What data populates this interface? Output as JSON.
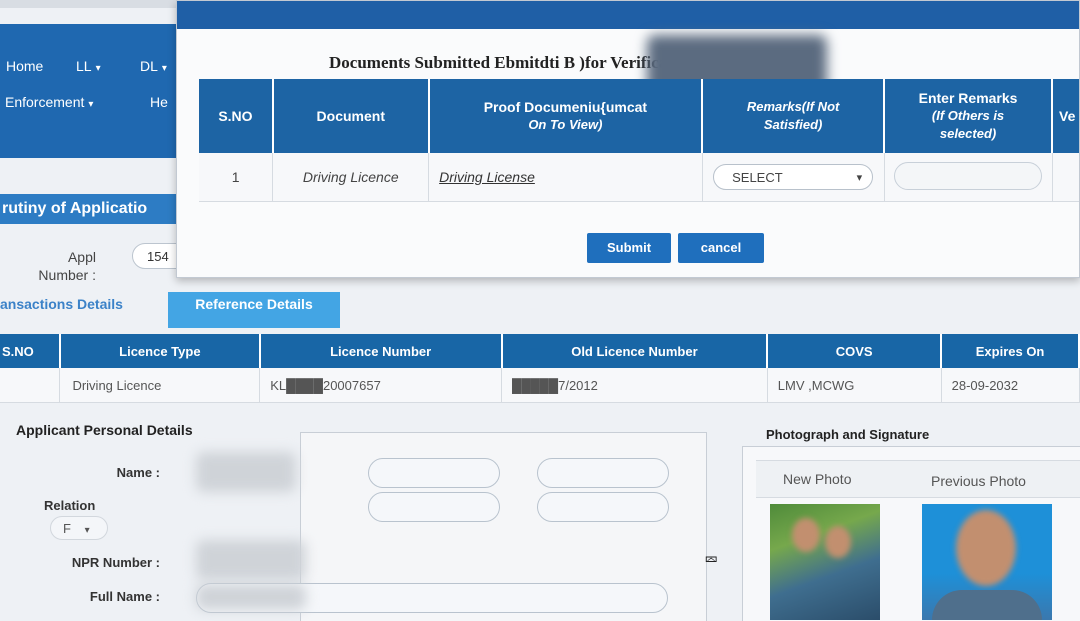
{
  "nav": {
    "row1": [
      {
        "label": "Home",
        "caret": false
      },
      {
        "label": "LL",
        "caret": true
      },
      {
        "label": "DL",
        "caret": true
      }
    ],
    "row2": [
      {
        "label": "Enforcement",
        "caret": true
      },
      {
        "label": "He",
        "caret": false
      }
    ]
  },
  "page": {
    "section_title": "rutiny of Applicatio",
    "appl_label_line1": "Appl",
    "appl_label_line2": "Number :",
    "appl_value": "154",
    "tabs": [
      {
        "label": "ansactions Details",
        "active": false
      },
      {
        "label": "Reference Details",
        "active": true
      }
    ]
  },
  "licence_table": {
    "headers": [
      "S.NO",
      "Licence Type",
      "Licence Number",
      "Old Licence Number",
      "COVS",
      "Expires On"
    ],
    "rows": [
      [
        "",
        "Driving Licence",
        "KL████20007657",
        "█████7/2012",
        "LMV ,MCWG",
        "28-09-2032"
      ]
    ]
  },
  "personal": {
    "title": "Applicant Personal Details",
    "name_label": "Name :",
    "relation_label": "Relation",
    "relation_value": "F",
    "npr_label": "NPR Number :",
    "full_name_label": "Full Name :"
  },
  "photo": {
    "title": "Photograph and Signature",
    "new_label": "New Photo",
    "prev_label": "Previous Photo"
  },
  "modal": {
    "title": "Documents Submitted Ebmitdti                 B )for Verification",
    "headers": {
      "sno": "S.NO",
      "document": "Document",
      "proof_line1": "Proof Documeniu{umcat",
      "proof_line2": "On To View)",
      "remarks_line1": "Remarks(If Not",
      "remarks_line2": "Satisfied)",
      "enter_line1": "Enter Remarks",
      "enter_line2": "(If Others is",
      "enter_line3": "selected)",
      "extra": "Ve"
    },
    "row": {
      "sno": "1",
      "document": "Driving Licence",
      "proof": "Driving License",
      "remarks_select": "SELECT"
    },
    "submit_label": "Submit",
    "cancel_label": "cancel"
  }
}
